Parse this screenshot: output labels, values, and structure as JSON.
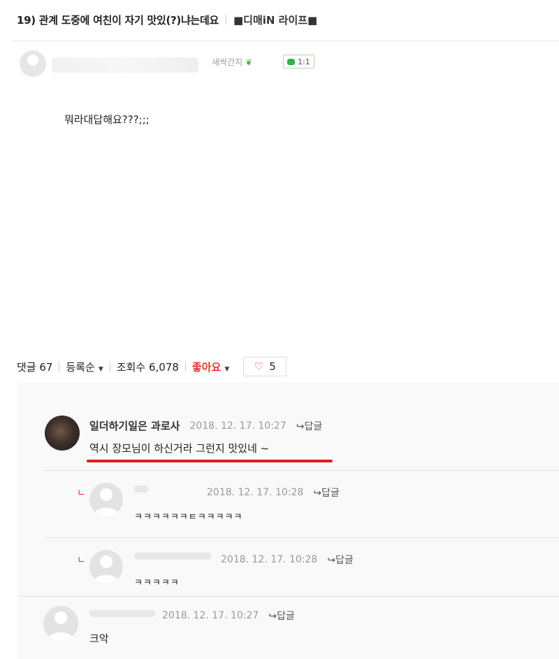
{
  "post": {
    "title": "19) 관계 도중에 여친이 자기 맛있(?)냐는데요",
    "board": "■디매iN 라이프■",
    "author_rank": "새싹간지",
    "chat_count": "1:1",
    "body": "뭐라대답해요???;;;"
  },
  "stats": {
    "comments": "댓글 67",
    "sort": "등록순",
    "views": "조회수 6,078",
    "likes_label": "좋아요",
    "likes_count": "5"
  },
  "comments": [
    {
      "name": "일더하기일은 과로사",
      "date": "2018. 12. 17.  10:27",
      "reply": "답글",
      "text": "역시 장모님이 하신거라 그런지 맛있네 ~"
    },
    {
      "date": "2018. 12. 17.  10:28",
      "reply": "답글",
      "text": "ㅋㅋㅋㅋㅋㅋㅌㅋㅋㅋㅋㅋ"
    },
    {
      "date": "2018. 12. 17.  10:28",
      "reply": "답글",
      "text": "ㅋㅋㅋㅋㅋ"
    },
    {
      "date": "2018. 12. 17.  10:27",
      "reply": "답글",
      "text": "크악"
    }
  ],
  "icons": {
    "reply_arrow": "reply-arrow-icon",
    "heart": "heart-icon",
    "sprout": "sprout-icon",
    "chat": "chat-icon"
  },
  "colors": {
    "accent_red": "#e5322d",
    "chat_green": "#2fb44c",
    "underline_red": "#d8201f"
  }
}
